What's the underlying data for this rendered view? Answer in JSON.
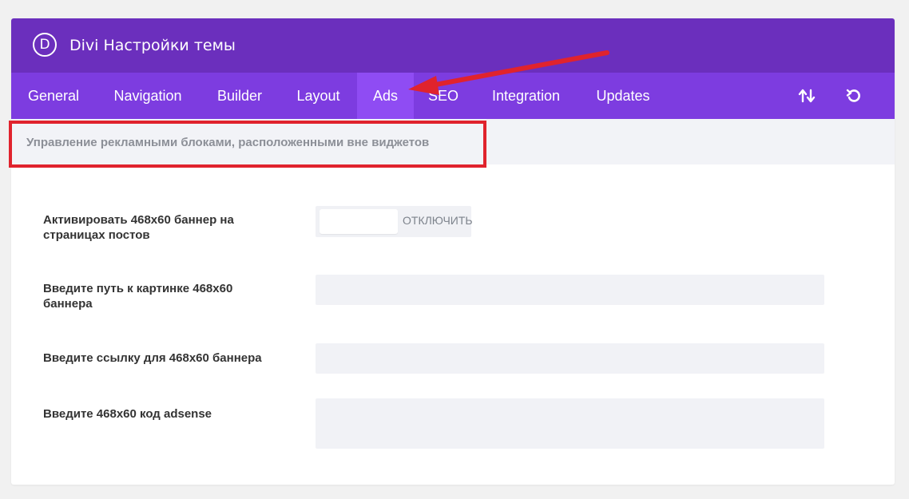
{
  "header": {
    "logo_letter": "D",
    "title": "Divi Настройки темы"
  },
  "tabs": [
    {
      "label": "General",
      "active": false
    },
    {
      "label": "Navigation",
      "active": false
    },
    {
      "label": "Builder",
      "active": false
    },
    {
      "label": "Layout",
      "active": false
    },
    {
      "label": "Ads",
      "active": true
    },
    {
      "label": "SEO",
      "active": false
    },
    {
      "label": "Integration",
      "active": false
    },
    {
      "label": "Updates",
      "active": false
    }
  ],
  "toolbar_icons": [
    "import-export-icon",
    "reset-icon"
  ],
  "section": {
    "description": "Управление рекламными блоками, расположенными вне виджетов"
  },
  "settings": [
    {
      "label": "Активировать 468x60 баннер на страницах постов",
      "control": "toggle",
      "value": "ОТКЛЮЧИТЬ"
    },
    {
      "label": "Введите путь к картинке 468x60 баннера",
      "control": "input",
      "value": ""
    },
    {
      "label": "Введите ссылку для 468x60 баннера",
      "control": "input",
      "value": ""
    },
    {
      "label": "Введите 468x60 код adsense",
      "control": "textarea",
      "value": ""
    }
  ],
  "colors": {
    "header_bg": "#6b2fbd",
    "tabbar_bg": "#7d3ce0",
    "active_tab_bg": "#8f4cf3",
    "annotation_red": "#e0232d"
  }
}
